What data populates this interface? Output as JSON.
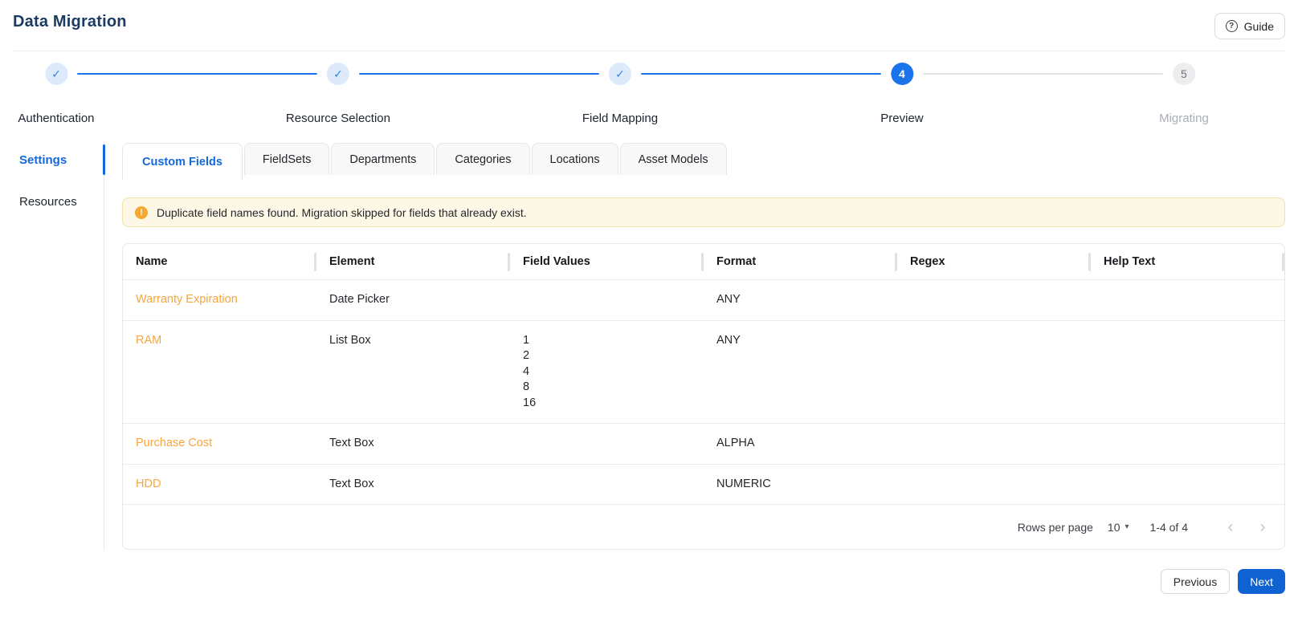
{
  "header": {
    "title": "Data Migration",
    "guide_button": "Guide"
  },
  "icons": {
    "help": "?",
    "warning": "!",
    "check": "✓",
    "dropdown": "▾",
    "chevron_left": "‹",
    "chevron_right": "›"
  },
  "stepper": {
    "steps": [
      {
        "label": "Authentication",
        "state": "completed"
      },
      {
        "label": "Resource Selection",
        "state": "completed"
      },
      {
        "label": "Field Mapping",
        "state": "completed"
      },
      {
        "label": "Preview",
        "state": "active",
        "number": "4"
      },
      {
        "label": "Migrating",
        "state": "upcoming",
        "number": "5"
      }
    ]
  },
  "sidebar": {
    "items": [
      {
        "label": "Settings",
        "active": true
      },
      {
        "label": "Resources",
        "active": false
      }
    ]
  },
  "tabs": [
    {
      "label": "Custom Fields",
      "active": true
    },
    {
      "label": "FieldSets",
      "active": false
    },
    {
      "label": "Departments",
      "active": false
    },
    {
      "label": "Categories",
      "active": false
    },
    {
      "label": "Locations",
      "active": false
    },
    {
      "label": "Asset Models",
      "active": false
    }
  ],
  "banner": {
    "message": "Duplicate field names found. Migration skipped for fields that already exist."
  },
  "table": {
    "columns": [
      "Name",
      "Element",
      "Field Values",
      "Format",
      "Regex",
      "Help Text"
    ],
    "rows": [
      {
        "name": "Warranty Expiration",
        "element": "Date Picker",
        "field_values": [],
        "format": "ANY",
        "regex": "",
        "help_text": ""
      },
      {
        "name": "RAM",
        "element": "List Box",
        "field_values": [
          "1",
          "2",
          "4",
          "8",
          "16"
        ],
        "format": "ANY",
        "regex": "",
        "help_text": ""
      },
      {
        "name": "Purchase Cost",
        "element": "Text Box",
        "field_values": [],
        "format": "ALPHA",
        "regex": "",
        "help_text": ""
      },
      {
        "name": "HDD",
        "element": "Text Box",
        "field_values": [],
        "format": "NUMERIC",
        "regex": "",
        "help_text": ""
      }
    ],
    "pagination": {
      "rows_per_page_label": "Rows per page",
      "rows_per_page_value": "10",
      "range": "1-4 of 4"
    }
  },
  "footer": {
    "previous": "Previous",
    "next": "Next"
  },
  "colors": {
    "title_navy": "#1c3b63",
    "accent_blue": "#1568dc",
    "active_step_blue": "#1a73e8",
    "completed_step_bg": "#ddeafc",
    "link_orange": "#f8a63c",
    "warning_bg": "#fdf7e6",
    "warning_border": "#f1e1a8",
    "warning_icon_bg": "#f6a833",
    "next_button_blue": "#1062d3"
  }
}
